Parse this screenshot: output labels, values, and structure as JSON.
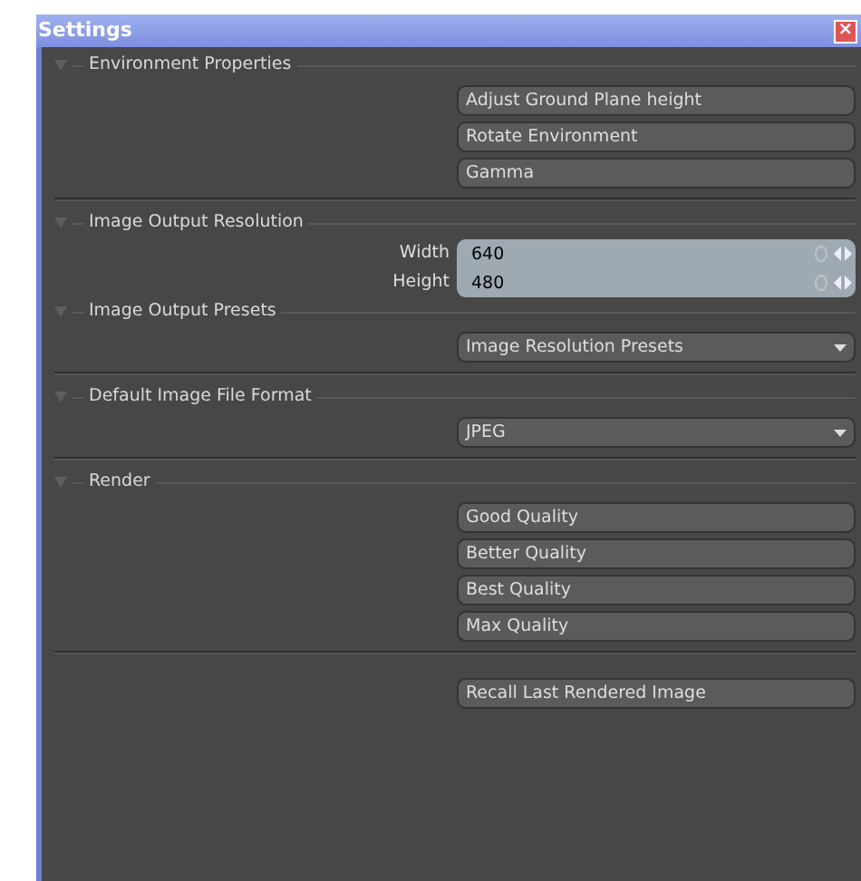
{
  "window": {
    "title": "Settings",
    "close": "×"
  },
  "sections": [
    {
      "title": "Environment Properties",
      "expanded": true,
      "divider": true,
      "items": [
        {
          "kind": "button",
          "label": "Adjust Ground Plane height"
        },
        {
          "kind": "button",
          "label": "Rotate Environment"
        },
        {
          "kind": "button",
          "label": "Gamma"
        }
      ]
    },
    {
      "title": "Image Output Resolution",
      "expanded": true,
      "divider": false,
      "items": [
        {
          "kind": "number",
          "label": "Width",
          "value": "640"
        },
        {
          "kind": "number",
          "label": "Height",
          "value": "480"
        }
      ]
    },
    {
      "title": "Image Output Presets",
      "expanded": true,
      "divider": true,
      "items": [
        {
          "kind": "dropdown",
          "label": "Image Resolution Presets"
        }
      ]
    },
    {
      "title": "Default Image File Format",
      "expanded": true,
      "divider": true,
      "items": [
        {
          "kind": "dropdown",
          "label": "JPEG"
        }
      ]
    },
    {
      "title": "Render",
      "expanded": true,
      "divider": true,
      "items": [
        {
          "kind": "button",
          "label": "Good Quality"
        },
        {
          "kind": "button",
          "label": "Better Quality"
        },
        {
          "kind": "button",
          "label": "Best Quality"
        },
        {
          "kind": "button",
          "label": "Max Quality"
        }
      ]
    },
    {
      "divider": false,
      "items": [
        {
          "kind": "button",
          "label": "Recall Last Rendered Image"
        }
      ]
    }
  ]
}
